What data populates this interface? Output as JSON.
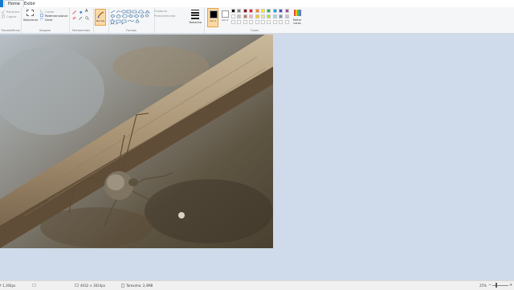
{
  "tabs": [
    "Home",
    "Exibir"
  ],
  "clipboard": {
    "items": [
      "Recortar",
      "Copiar"
    ],
    "group_label": "Transferência"
  },
  "image": {
    "select_label": "Selecionar",
    "items": [
      "Cortar",
      "Redimensionar",
      "Girar"
    ],
    "group_label": "Imagem"
  },
  "tools": {
    "group_label": "Ferramentas"
  },
  "brushes": {
    "label": "Pincéis"
  },
  "shapes": {
    "contour_label": "Contorno",
    "fill_label": "Preenchimento",
    "group_label": "Formas"
  },
  "size": {
    "label": "Tamanho"
  },
  "colors": {
    "color1_label": "Cor 1",
    "color2_label": "Cor 2",
    "edit_label": "Editar cores",
    "group_label": "Cores",
    "row1": [
      "#000000",
      "#7f7f7f",
      "#880015",
      "#ed1c24",
      "#ff7f27",
      "#fff200",
      "#22b14c",
      "#00a2e8",
      "#3f48cc",
      "#a349a4"
    ],
    "row2": [
      "#ffffff",
      "#c3c3c3",
      "#b97a57",
      "#ffaec9",
      "#ffc90e",
      "#efe4b0",
      "#b5e61d",
      "#99d9ea",
      "#7092be",
      "#c8bfe7"
    ],
    "row3": [
      "#ffffff",
      "#ffffff",
      "#ffffff",
      "#ffffff",
      "#ffffff",
      "#ffffff",
      "#ffffff",
      "#ffffff",
      "#ffffff",
      "#ffffff"
    ]
  },
  "status": {
    "cursor": "1,160px",
    "dimensions": "4032 × 3024px",
    "filesize": "Tamanho: 2,4MB",
    "zoom": "25%"
  }
}
